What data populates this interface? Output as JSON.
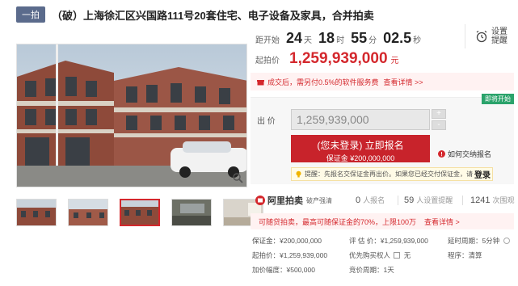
{
  "header": {
    "round_tag": "一拍",
    "title": "（破）上海徐汇区兴国路111号20套住宅、电子设备及家具，合并拍卖"
  },
  "countdown": {
    "label": "距开始",
    "days": "24",
    "days_unit": "天",
    "hours": "18",
    "hours_unit": "时",
    "minutes": "55",
    "minutes_unit": "分",
    "seconds": "02.5",
    "seconds_unit": "秒"
  },
  "start_price": {
    "label": "起拍价",
    "value": "1,259,939,000",
    "unit": "元"
  },
  "reminder": {
    "label": "设置提醒"
  },
  "service_notice": {
    "text": "成交后，需另付0.5%的软件服务费",
    "link": "查看详情 >>"
  },
  "bid": {
    "status_tag": "即将开始",
    "label": "出 价",
    "value": "1,259,939,000",
    "increment_symbol": "+",
    "decrement_symbol": "-",
    "register_line1": "(您未登录) 立即报名",
    "register_line2": "保证金 ¥200,000,000",
    "how_pay": "如何交纳报名",
    "tip_text": "提醒：先报名交保证金再出价。如果您已经交付保证金，请",
    "tip_login": "登录"
  },
  "ali": {
    "brand": "阿里拍卖",
    "sub": "破产强清",
    "signups_value": "0",
    "signups_label": "人报名",
    "reminders_value": "59",
    "reminders_label": "人设置提醒",
    "views_value": "1241",
    "views_label": "次围观"
  },
  "installment": {
    "text": "可随贷拍卖，最高可随保证金的70%，上限100万",
    "link": "查看详情 >"
  },
  "info": {
    "deposit": "保证金：¥200,000,000",
    "appraisal": "评 估 价：¥1,259,939,000",
    "delay": "延时周期：5分钟",
    "start": "起拍价：¥1,259,939,000",
    "priority": "优先购买权人",
    "priority_value": "无",
    "procedure": "程序：清算",
    "increment": "加价幅度：¥500,000",
    "cycle": "竞价周期：1天"
  },
  "colors": {
    "accent": "#d4282d",
    "tag_bg": "#5b6b8c",
    "green": "#2aa36b"
  }
}
